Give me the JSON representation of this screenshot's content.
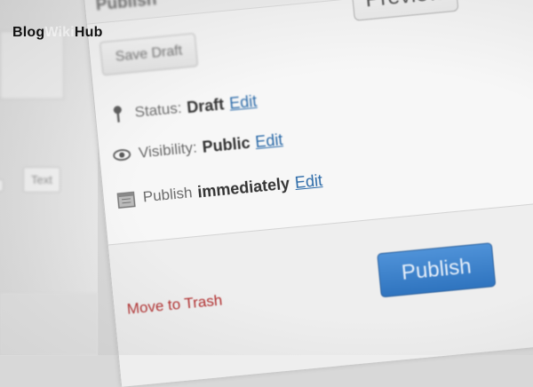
{
  "watermark": {
    "part1": "Blog",
    "part2": "Wiki",
    "part3": "Hub"
  },
  "publish_box": {
    "title": "Publish",
    "preview_label": "Preview",
    "save_draft_label": "Save Draft",
    "status": {
      "label": "Status:",
      "value": "Draft",
      "edit": "Edit"
    },
    "visibility": {
      "label": "Visibility:",
      "value": "Public",
      "edit": "Edit"
    },
    "schedule": {
      "label": "Publish",
      "value": "immediately",
      "edit": "Edit"
    },
    "trash_label": "Move to Trash",
    "publish_label": "Publish"
  },
  "left": {
    "button1": "",
    "button2": "Text"
  },
  "icons": {
    "status": "key-icon",
    "visibility": "eye-icon",
    "schedule": "calendar-icon"
  },
  "colors": {
    "edit_link": "#2b6aa8",
    "publish_button": "#3a7fc8",
    "trash_link": "#b02a2a"
  }
}
